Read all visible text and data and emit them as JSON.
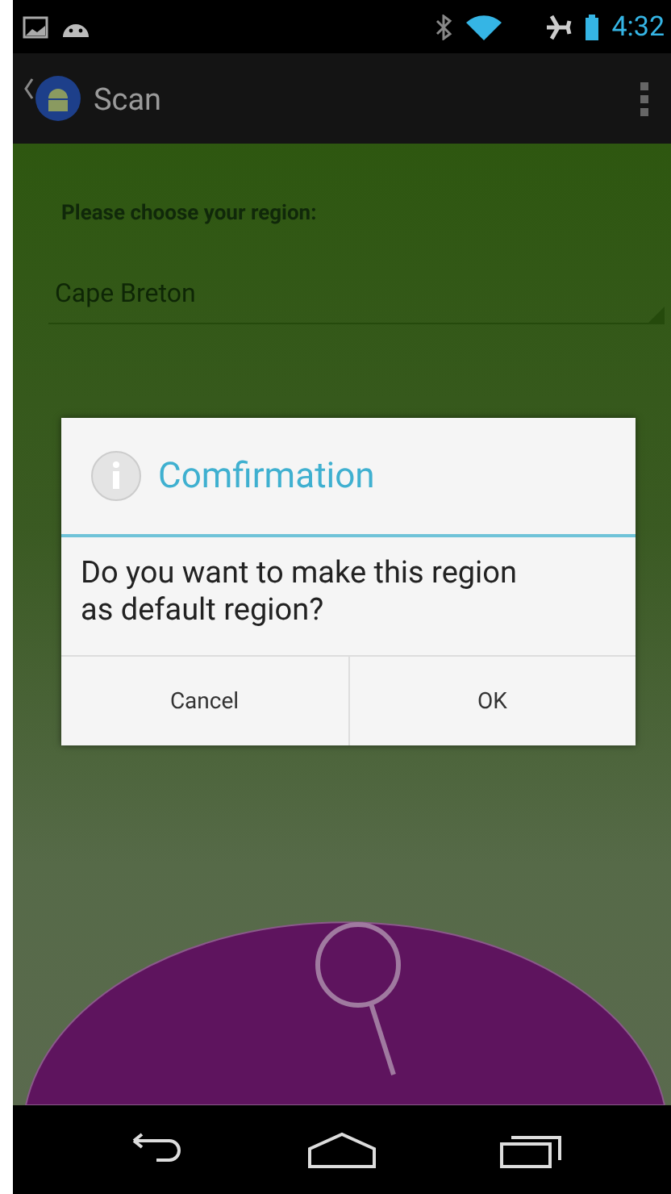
{
  "status_bar": {
    "time": "4:32"
  },
  "action_bar": {
    "title": "Scan"
  },
  "region_prompt": "Please choose your region:",
  "region_spinner": {
    "value": "Cape Breton"
  },
  "dialog": {
    "title": "Comfirmation",
    "message": "Do you want to make this region as default region?",
    "buttons": [
      "Cancel",
      "OK"
    ]
  }
}
